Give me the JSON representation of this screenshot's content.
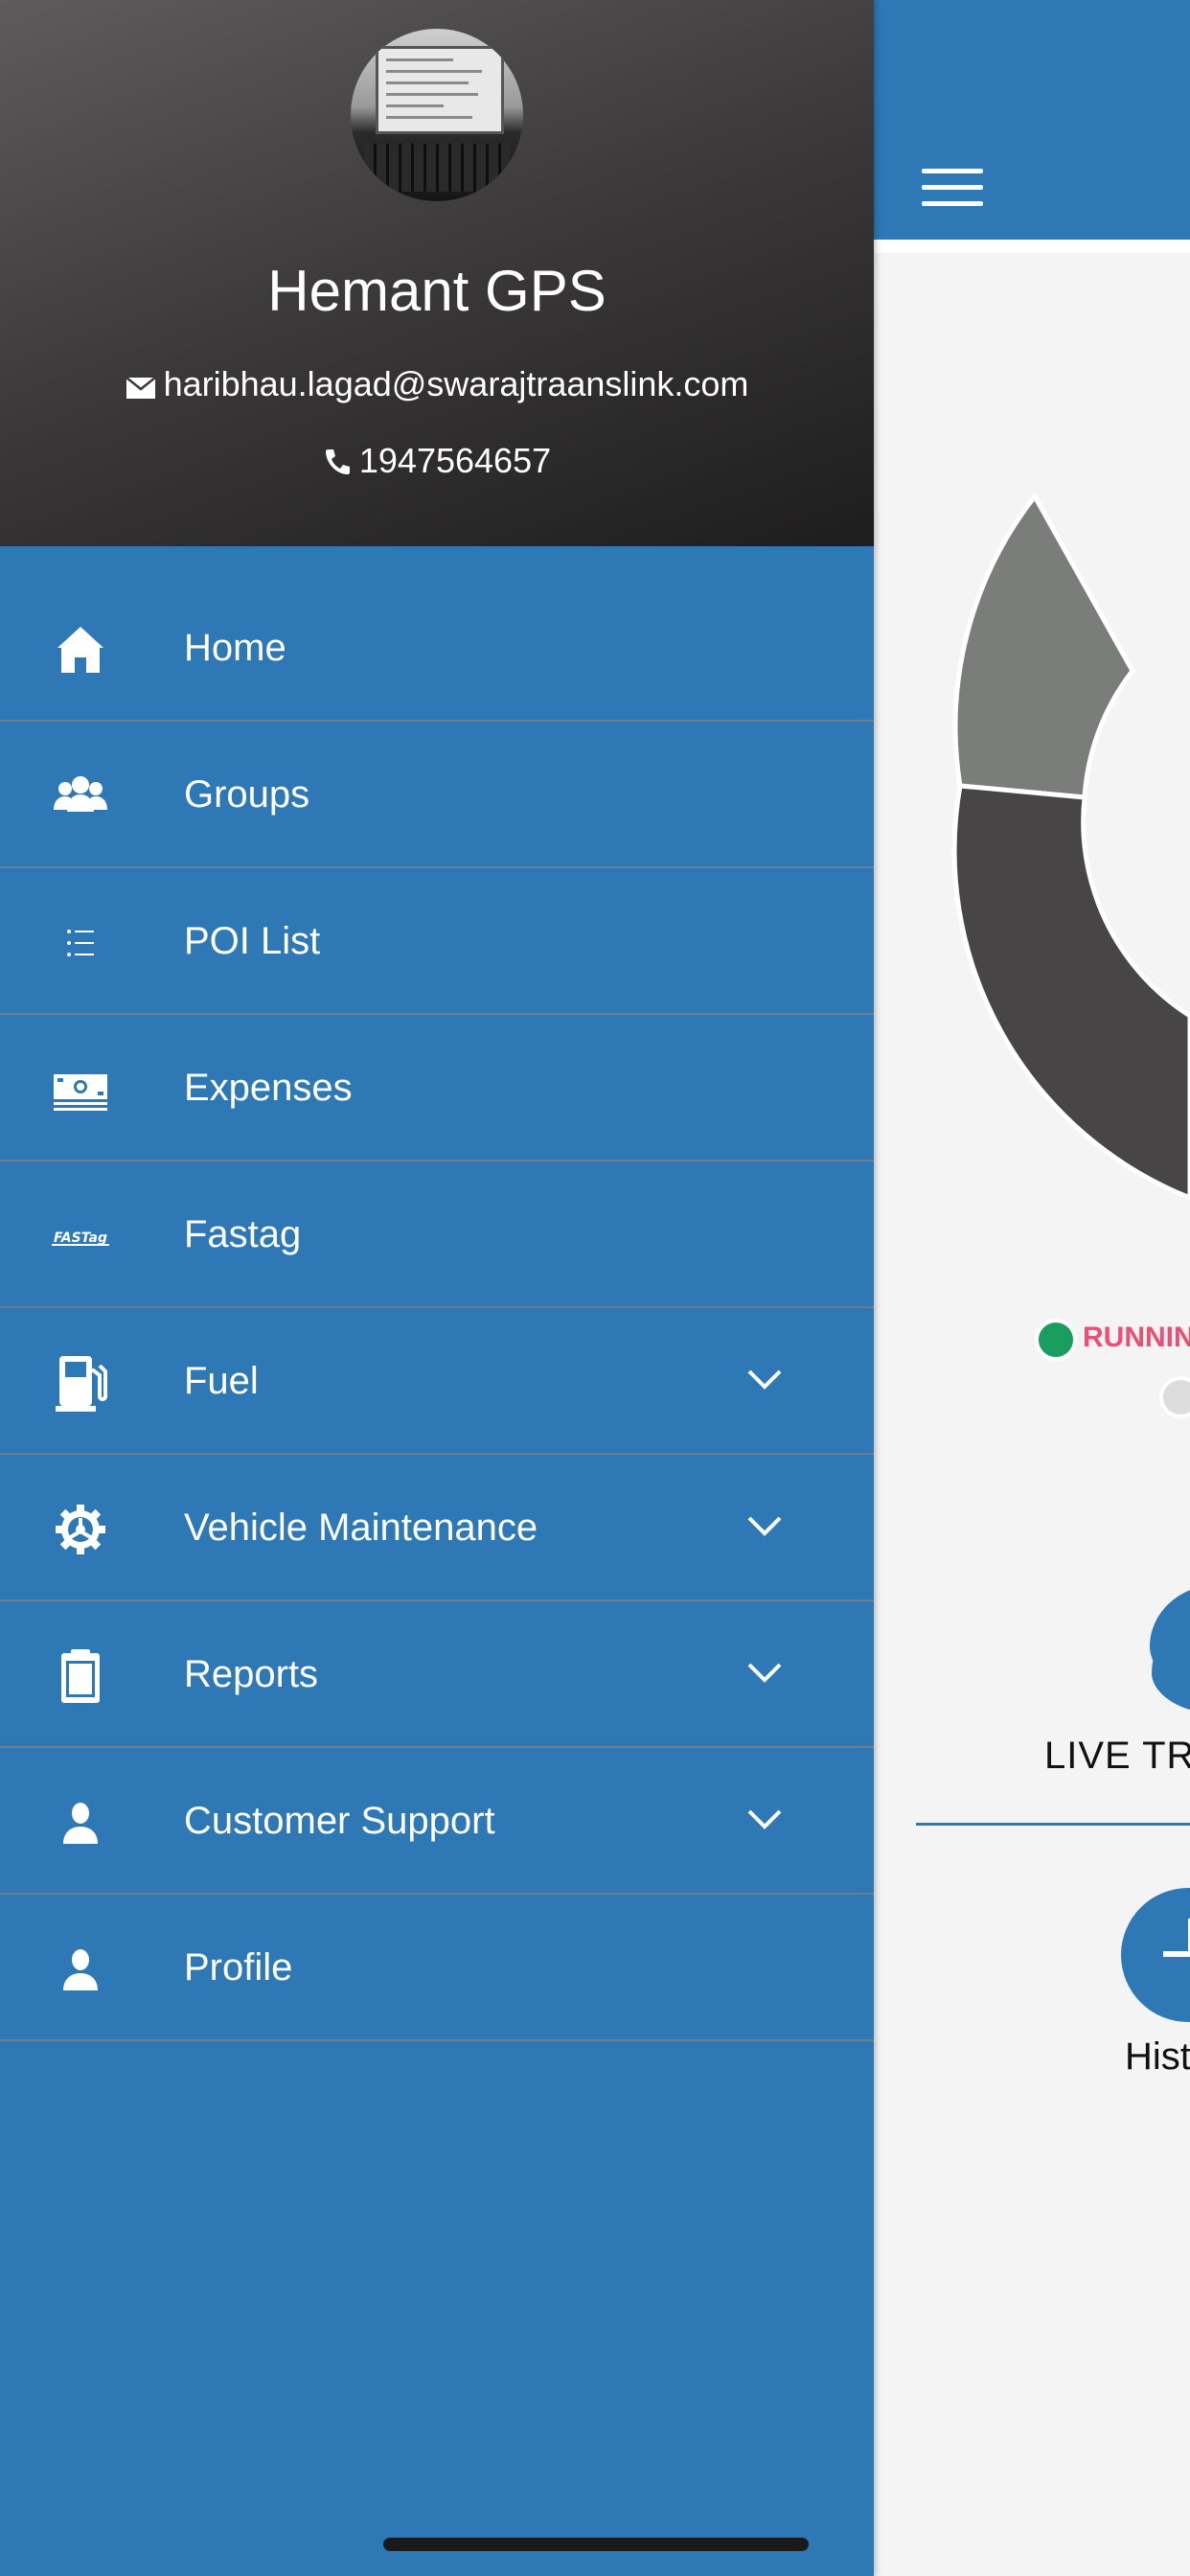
{
  "profile": {
    "name": "Hemant GPS",
    "email": "haribhau.lagad@swarajtraanslink.com",
    "phone": "1947564657"
  },
  "menu": {
    "items": [
      {
        "label": "Home",
        "icon": "home-icon",
        "expandable": false
      },
      {
        "label": "Groups",
        "icon": "groups-icon",
        "expandable": false
      },
      {
        "label": "POI List",
        "icon": "list-icon",
        "expandable": false
      },
      {
        "label": "Expenses",
        "icon": "money-icon",
        "expandable": false
      },
      {
        "label": "Fastag",
        "icon": "fastag-icon",
        "expandable": false
      },
      {
        "label": "Fuel",
        "icon": "fuel-pump-icon",
        "expandable": true
      },
      {
        "label": "Vehicle Maintenance",
        "icon": "gear-icon",
        "expandable": true
      },
      {
        "label": "Reports",
        "icon": "clipboard-icon",
        "expandable": true
      },
      {
        "label": "Customer Support",
        "icon": "person-icon",
        "expandable": true
      },
      {
        "label": "Profile",
        "icon": "person-icon",
        "expandable": false
      }
    ]
  },
  "background_screen": {
    "legend_running": "RUNNIN",
    "live_tracking_label": "LIVE TR",
    "history_label": "Hist"
  },
  "colors": {
    "drawer_blue": "#2e79b5",
    "running_green": "#1a9e5f",
    "running_label": "#ec4f73",
    "donut_gray_light": "#7a7d7a",
    "donut_gray_dark": "#474546"
  }
}
